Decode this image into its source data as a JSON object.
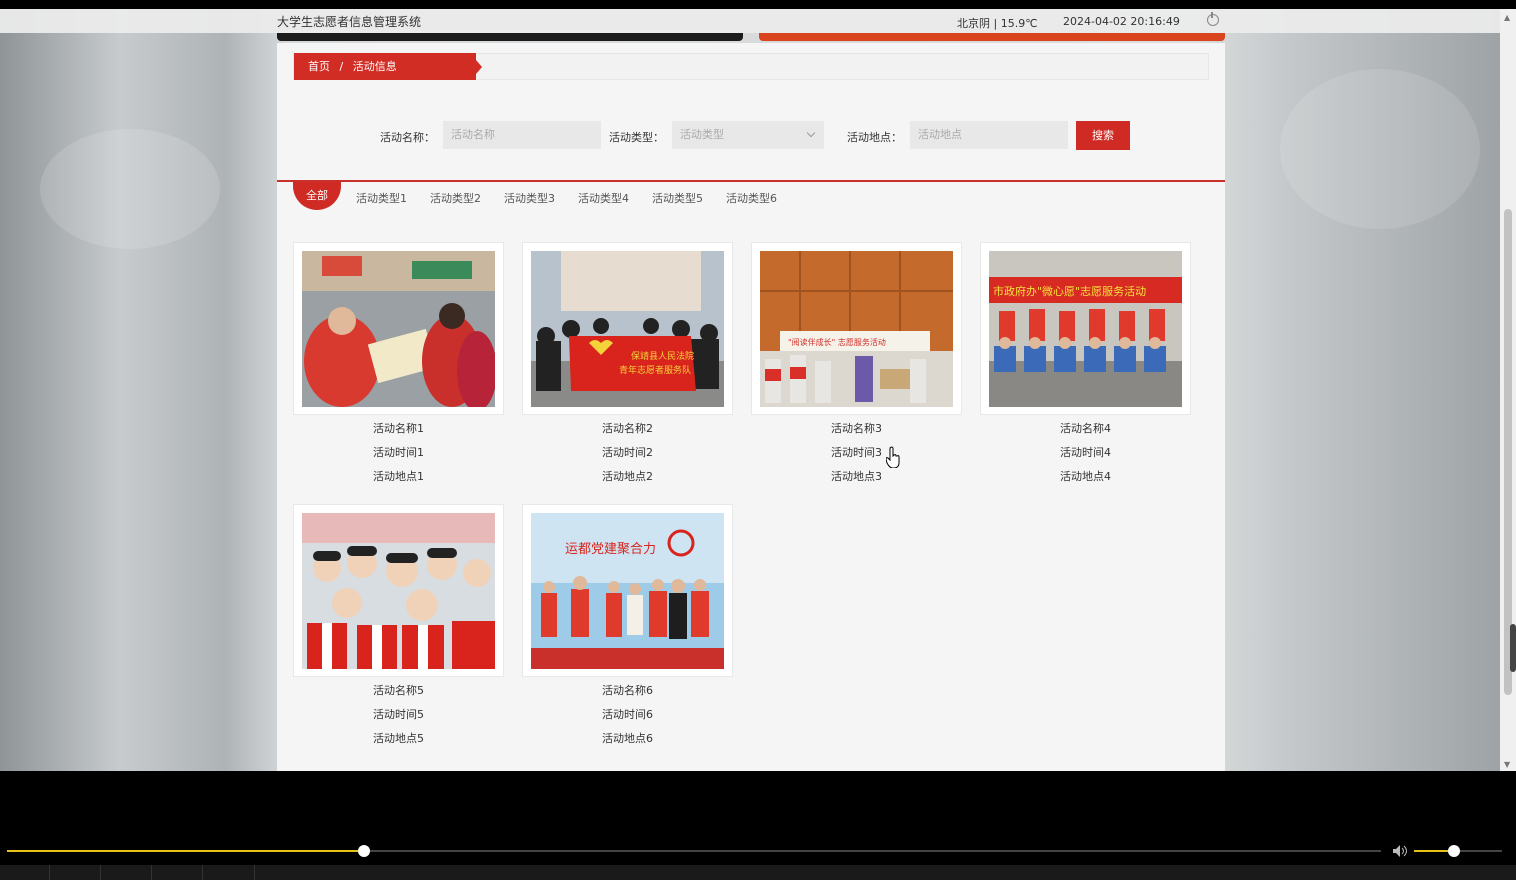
{
  "header": {
    "site_title": "大学生志愿者信息管理系统",
    "weather": "北京阴 | 15.9℃",
    "datetime": "2024-04-02   20:16:49"
  },
  "breadcrumb": {
    "home": "首页",
    "separator": "/",
    "current": "活动信息"
  },
  "search": {
    "name_label": "活动名称：",
    "name_placeholder": "活动名称",
    "type_label": "活动类型：",
    "type_placeholder": "活动类型",
    "place_label": "活动地点：",
    "place_placeholder": "活动地点",
    "button": "搜索"
  },
  "tabs": [
    "全部",
    "活动类型1",
    "活动类型2",
    "活动类型3",
    "活动类型4",
    "活动类型5",
    "活动类型6"
  ],
  "activities": [
    {
      "name": "活动名称1",
      "time": "活动时间1",
      "place": "活动地点1"
    },
    {
      "name": "活动名称2",
      "time": "活动时间2",
      "place": "活动地点2"
    },
    {
      "name": "活动名称3",
      "time": "活动时间3",
      "place": "活动地点3"
    },
    {
      "name": "活动名称4",
      "time": "活动时间4",
      "place": "活动地点4"
    },
    {
      "name": "活动名称5",
      "time": "活动时间5",
      "place": "活动地点5"
    },
    {
      "name": "活动名称6",
      "time": "活动时间6",
      "place": "活动地点6"
    }
  ],
  "photo_text": {
    "banner2_line1": "保靖县人民法院",
    "banner2_line2": "青年志愿者服务队",
    "banner3": "\"阅读伴成长\" 志愿服务活动",
    "banner4": "市政府办\"微心愿\"志愿服务活动",
    "banner6": "运都党建聚合力"
  },
  "player": {
    "progress": 0.26,
    "volume": 0.45
  },
  "colors": {
    "accent": "#cf2a24",
    "seek": "#e8c21a"
  }
}
